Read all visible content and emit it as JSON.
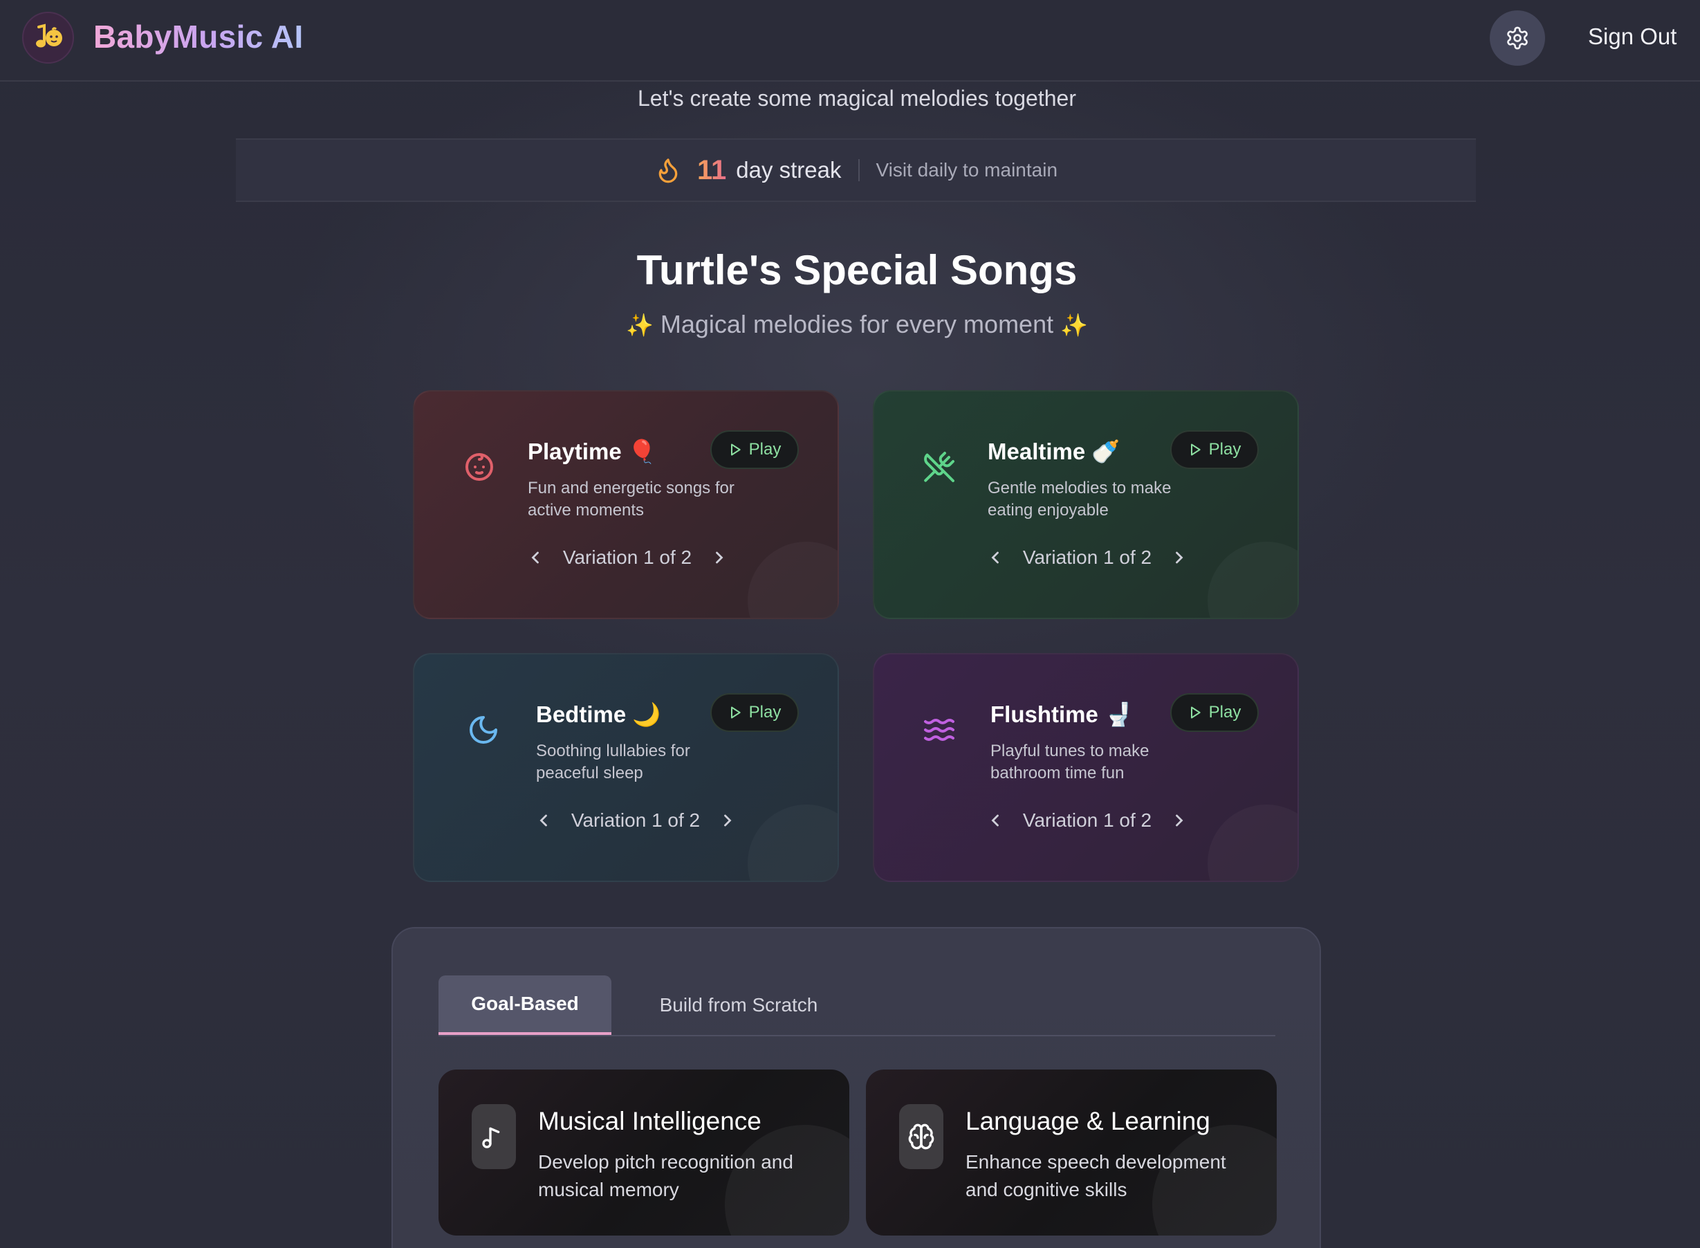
{
  "header": {
    "brand": "BabyMusic AI",
    "signout_label": "Sign Out",
    "settings_icon": "gear-icon",
    "logo_icon": "music-note-baby-logo"
  },
  "welcome": {
    "subtitle": "Let's create some magical melodies together"
  },
  "streak": {
    "count": "11",
    "label": "day streak",
    "hint": "Visit daily to maintain",
    "icon": "flame-icon"
  },
  "songs": {
    "title": "Turtle's Special Songs",
    "subtitle": "Magical melodies for every moment",
    "sparkle": "✨",
    "play_label": "Play",
    "cards": [
      {
        "title": "Playtime 🎈",
        "description": "Fun and energetic songs for active moments",
        "variation": "Variation 1 of 2",
        "icon": "baby-face-icon",
        "accent": "#e0606a"
      },
      {
        "title": "Mealtime 🍼",
        "description": "Gentle melodies to make eating enjoyable",
        "variation": "Variation 1 of 2",
        "icon": "utensils-crossed-icon",
        "accent": "#5ed48a"
      },
      {
        "title": "Bedtime 🌙",
        "description": "Soothing lullabies for peaceful sleep",
        "variation": "Variation 1 of 2",
        "icon": "moon-icon",
        "accent": "#6ab8f0"
      },
      {
        "title": "Flushtime 🚽",
        "description": "Playful tunes to make bathroom time fun",
        "variation": "Variation 1 of 2",
        "icon": "waves-icon",
        "accent": "#c060e0"
      }
    ]
  },
  "builder": {
    "tabs": [
      {
        "label": "Goal-Based",
        "active": true
      },
      {
        "label": "Build from Scratch",
        "active": false
      }
    ],
    "goals": [
      {
        "title": "Musical Intelligence",
        "description": "Develop pitch recognition and musical memory",
        "icon": "music-note-icon"
      },
      {
        "title": "Language & Learning",
        "description": "Enhance speech development and cognitive skills",
        "icon": "brain-icon"
      }
    ]
  }
}
